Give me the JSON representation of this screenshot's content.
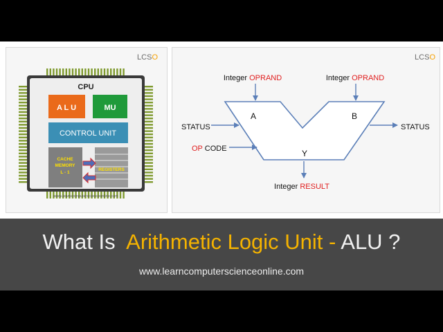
{
  "cpu_panel": {
    "logo": {
      "prefix": "LCS",
      "accent": "O"
    },
    "cpu_label": "CPU",
    "alu_label": "A L U",
    "mu_label": "MU",
    "control_unit_label": "CONTROL UNIT",
    "cache_label_lines": [
      "CACHE",
      "MEMORY",
      "L - 1"
    ],
    "registers_label": "REGISTERS",
    "watermark": "www.learncomputerscienceonline.com"
  },
  "alu_panel": {
    "logo": {
      "prefix": "LCS",
      "accent": "O"
    },
    "operand_a": {
      "prefix": "Integer ",
      "highlight": "OPRAND"
    },
    "operand_b": {
      "prefix": "Integer ",
      "highlight": "OPRAND"
    },
    "label_a": "A",
    "label_b": "B",
    "label_y": "Y",
    "status_in": "STATUS",
    "status_out": "STATUS",
    "opcode": {
      "highlight": "OP",
      "suffix": " CODE"
    },
    "result": {
      "prefix": "Integer ",
      "highlight": "RESULT"
    }
  },
  "banner": {
    "title_prefix": "What Is  ",
    "title_highlight": "Arithmetic Logic Unit - ",
    "title_suffix": "ALU ?",
    "url": "www.learncomputerscienceonline.com"
  },
  "colors": {
    "alu_box": "#ea6a1a",
    "mu_box": "#1f9a3a",
    "control_unit": "#3b8fb5",
    "cache_box": "#7f7f7f",
    "register_box": "#9a9a9a",
    "arrow_red": "#d42a2a",
    "arrow_blue": "#4f6db8",
    "chip_pins": "#7f9a2e",
    "text_red": "#e02020",
    "logo_accent": "#f5a000",
    "banner_highlight": "#f5b300"
  }
}
